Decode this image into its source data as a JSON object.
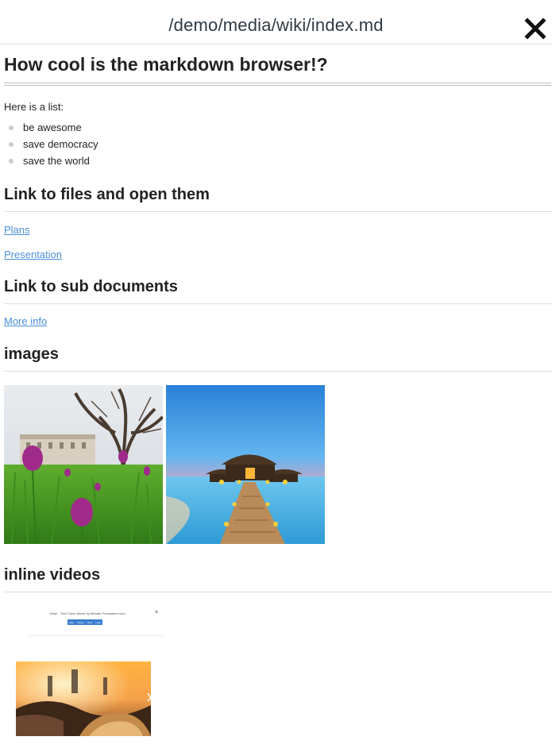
{
  "header": {
    "title": "/demo/media/wiki/index.md"
  },
  "doc": {
    "title": "How cool is the markdown browser!?",
    "intro": "Here is a list:",
    "list_items": [
      "be awesome",
      "save democracy",
      "save the world"
    ],
    "section_files": {
      "heading": "Link to files and open them",
      "links": [
        "Plans",
        "Presentation"
      ]
    },
    "section_sub": {
      "heading": "Link to sub documents",
      "links": [
        "More info"
      ]
    },
    "section_images": {
      "heading": "images"
    },
    "section_videos": {
      "heading": "inline videos"
    }
  },
  "video": {
    "title": "Sintel - Third Open Movie by Blender Foundation.mp4",
    "buttons": [
      "Play",
      "Pause",
      "Next",
      "Loop"
    ]
  },
  "colors": {
    "link": "#4a90d9",
    "heading": "#222222",
    "title": "#2f3a44"
  },
  "icons": {
    "close": "close-icon",
    "bullet": "bullet-dot-icon"
  }
}
